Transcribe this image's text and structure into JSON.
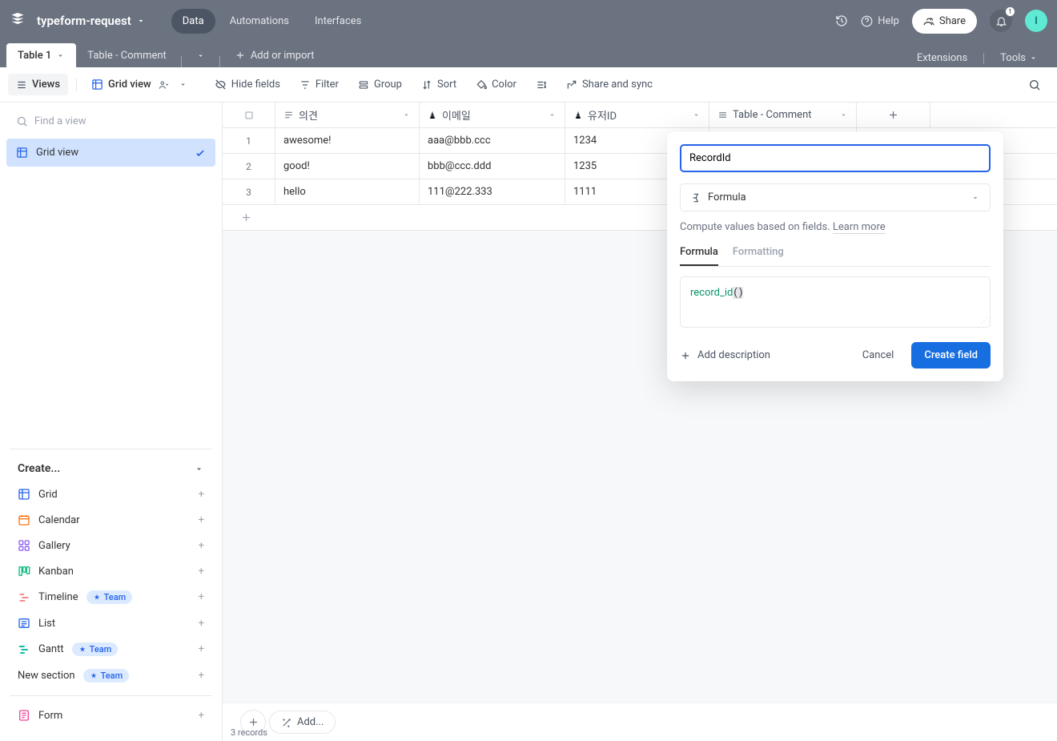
{
  "header": {
    "workspace_name": "typeform-request",
    "tabs": {
      "data": "Data",
      "automations": "Automations",
      "interfaces": "Interfaces"
    },
    "help": "Help",
    "share": "Share",
    "notif_count": "1",
    "avatar_initial": "I"
  },
  "tabs_bar": {
    "table1": "Table 1",
    "table_comment": "Table - Comment",
    "add_import": "Add or import",
    "extensions": "Extensions",
    "tools": "Tools"
  },
  "toolbar": {
    "views": "Views",
    "grid_view": "Grid view",
    "hide_fields": "Hide fields",
    "filter": "Filter",
    "group": "Group",
    "sort": "Sort",
    "color": "Color",
    "share_sync": "Share and sync"
  },
  "sidebar": {
    "find_placeholder": "Find a view",
    "grid_view": "Grid view",
    "create_label": "Create...",
    "items": {
      "grid": "Grid",
      "calendar": "Calendar",
      "gallery": "Gallery",
      "kanban": "Kanban",
      "timeline": "Timeline",
      "list": "List",
      "gantt": "Gantt",
      "new_section": "New section",
      "form": "Form"
    },
    "team_badge": "Team"
  },
  "grid": {
    "columns": {
      "c1": "의견",
      "c2": "이메일",
      "c3": "유저ID",
      "c4": "Table - Comment"
    },
    "rows": [
      {
        "n": "1",
        "c1": "awesome!",
        "c2": "aaa@bbb.ccc",
        "c3": "1234"
      },
      {
        "n": "2",
        "c1": "good!",
        "c2": "bbb@ccc.ddd",
        "c3": "1235"
      },
      {
        "n": "3",
        "c1": "hello",
        "c2": "111@222.333",
        "c3": "1111"
      }
    ],
    "footer_add": "Add...",
    "record_count": "3 records"
  },
  "popover": {
    "input_value": "RecordId",
    "field_type": "Formula",
    "description": "Compute values based on fields.",
    "learn_more": "Learn more",
    "tab_formula": "Formula",
    "tab_formatting": "Formatting",
    "formula_fn": "record_id",
    "add_description": "Add description",
    "cancel": "Cancel",
    "create": "Create field"
  }
}
